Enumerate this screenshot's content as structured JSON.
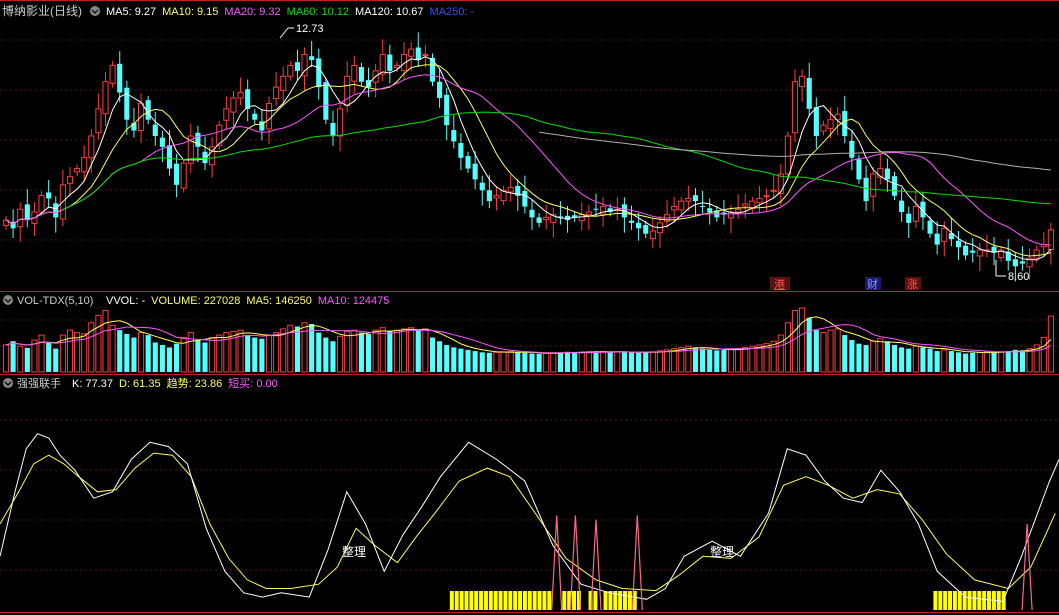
{
  "colors": {
    "bg": "#000000",
    "divider": "#c02020",
    "grid": "#551818",
    "up": "#ff3c3c",
    "down": "#54ffff",
    "ma5": "#ffffff",
    "ma10": "#ffff55",
    "ma20": "#ff55ff",
    "ma60": "#00e000",
    "ma120": "#b0b0b0",
    "ma250": "#3050ff",
    "k_line": "#ffffff",
    "d_line": "#ffff55",
    "trend_line": "#ffffff",
    "short_buy": "#ff6688",
    "yellow_bar": "#ffff00",
    "label_text": "#cccccc",
    "tag_bg": "#5a1010",
    "tag_bg_blue": "#1a1a6a"
  },
  "main_panel": {
    "title": "博纳影业(日线)",
    "indicators": [
      {
        "label": "MA5: 9.27",
        "color": "#ffffff"
      },
      {
        "label": "MA10: 9.15",
        "color": "#ffff55"
      },
      {
        "label": "MA20: 9.32",
        "color": "#ff55ff"
      },
      {
        "label": "MA60: 10.12",
        "color": "#00e000"
      },
      {
        "label": "MA120: 10.67",
        "color": "#ffffff"
      },
      {
        "label": "MA250: -",
        "color": "#3050ff"
      }
    ],
    "high_label": "12.73",
    "low_label": "8.60",
    "event_tags": [
      {
        "text": "港",
        "kind": "red"
      },
      {
        "text": "财",
        "kind": "blue"
      },
      {
        "text": "涨",
        "kind": "red"
      }
    ]
  },
  "volume_panel": {
    "title": "VOL-TDX(5,10)",
    "indicators": [
      {
        "label": "VVOL: -",
        "color": "#ffffff"
      },
      {
        "label": "VOLUME: 227028",
        "color": "#ffff55"
      },
      {
        "label": "MA5: 146250",
        "color": "#ffff55"
      },
      {
        "label": "MA10: 124475",
        "color": "#ff55ff"
      }
    ]
  },
  "oscillator_panel": {
    "title": "强强联手",
    "indicators": [
      {
        "label": "K: 77.37",
        "color": "#ffffff"
      },
      {
        "label": "D: 61.35",
        "color": "#ffff55"
      },
      {
        "label": "趋势: 23.86",
        "color": "#ffff55"
      },
      {
        "label": "短买: 0.00",
        "color": "#ff55ff"
      }
    ],
    "annotations": [
      "整理",
      "整理"
    ]
  },
  "chart_data": [
    {
      "type": "candlestick",
      "title": "博纳影业(日线)",
      "ylim": [
        8.2,
        13.1
      ],
      "closes": [
        9.45,
        9.3,
        9.65,
        9.45,
        9.6,
        9.9,
        9.85,
        9.5,
        10.1,
        10.25,
        10.4,
        10.6,
        11.0,
        11.5,
        12.0,
        12.3,
        11.8,
        11.3,
        11.1,
        11.6,
        11.3,
        11.0,
        10.8,
        10.4,
        10.1,
        10.5,
        11.0,
        10.8,
        10.5,
        10.8,
        11.2,
        11.5,
        11.7,
        11.8,
        11.5,
        11.3,
        11.1,
        11.6,
        11.9,
        12.1,
        12.3,
        12.2,
        12.5,
        12.4,
        11.9,
        11.3,
        11.0,
        11.5,
        12.1,
        12.3,
        12.0,
        11.9,
        12.2,
        12.5,
        12.2,
        12.3,
        12.5,
        12.6,
        12.4,
        12.5,
        12.0,
        11.7,
        11.2,
        10.9,
        10.6,
        10.4,
        10.2,
        10.0,
        9.8,
        9.9,
        10.0,
        10.05,
        9.9,
        9.7,
        9.5,
        9.4,
        9.5,
        9.55,
        9.5,
        9.45,
        9.5,
        9.55,
        9.6,
        9.65,
        9.7,
        9.6,
        9.65,
        9.5,
        9.4,
        9.3,
        9.2,
        9.25,
        9.4,
        9.55,
        9.7,
        9.8,
        9.85,
        9.8,
        9.7,
        9.6,
        9.5,
        9.55,
        9.6,
        9.65,
        9.75,
        9.8,
        9.85,
        9.9,
        10.0,
        10.3,
        11.0,
        12.0,
        12.1,
        11.5,
        11.0,
        11.2,
        11.3,
        11.4,
        11.0,
        10.6,
        10.2,
        9.8,
        10.3,
        10.4,
        10.2,
        9.9,
        9.6,
        9.4,
        9.7,
        9.5,
        9.2,
        9.0,
        9.3,
        9.1,
        8.95,
        8.8,
        8.85,
        8.9,
        8.9,
        8.85,
        8.9,
        8.7,
        8.6,
        8.65,
        8.75,
        8.9,
        9.0,
        9.27
      ],
      "volumes": [
        110000,
        125000,
        105000,
        98000,
        130000,
        150000,
        120000,
        95000,
        150000,
        170000,
        160000,
        155000,
        200000,
        230000,
        250000,
        190000,
        170000,
        155000,
        140000,
        160000,
        150000,
        120000,
        110000,
        100000,
        115000,
        140000,
        160000,
        130000,
        120000,
        140000,
        150000,
        160000,
        165000,
        170000,
        150000,
        140000,
        135000,
        150000,
        160000,
        175000,
        190000,
        185000,
        200000,
        195000,
        160000,
        140000,
        125000,
        145000,
        165000,
        170000,
        160000,
        155000,
        170000,
        180000,
        165000,
        170000,
        175000,
        180000,
        170000,
        175000,
        140000,
        125000,
        110000,
        100000,
        95000,
        90000,
        85000,
        80000,
        78000,
        80000,
        82000,
        83000,
        80000,
        78000,
        75000,
        74000,
        76000,
        78000,
        80000,
        82000,
        81000,
        80000,
        82000,
        84000,
        83000,
        80000,
        82000,
        81000,
        79000,
        78000,
        80000,
        82000,
        86000,
        90000,
        95000,
        100000,
        105000,
        100000,
        95000,
        90000,
        88000,
        90000,
        92000,
        95000,
        100000,
        105000,
        110000,
        115000,
        125000,
        150000,
        200000,
        250000,
        280000,
        220000,
        170000,
        160000,
        170000,
        175000,
        150000,
        130000,
        115000,
        110000,
        125000,
        135000,
        125000,
        110000,
        100000,
        95000,
        105000,
        100000,
        95000,
        85000,
        90000,
        85000,
        80000,
        75000,
        78000,
        80000,
        82000,
        80000,
        82000,
        85000,
        90000,
        88000,
        95000,
        110000,
        140000,
        227028
      ],
      "series": [
        {
          "name": "MA5"
        },
        {
          "name": "MA10"
        },
        {
          "name": "MA20"
        },
        {
          "name": "MA60"
        },
        {
          "name": "MA120"
        }
      ]
    },
    {
      "type": "bar",
      "title": "VOL-TDX(5,10)",
      "series": [
        {
          "name": "MA5"
        },
        {
          "name": "MA10"
        }
      ]
    },
    {
      "type": "line",
      "title": "强强联手",
      "ylim": [
        0,
        100
      ],
      "k_anchors": [
        [
          0,
          25
        ],
        [
          8,
          55
        ],
        [
          14,
          75
        ],
        [
          20,
          82
        ],
        [
          26,
          80
        ],
        [
          32,
          72
        ],
        [
          40,
          65
        ],
        [
          50,
          52
        ],
        [
          60,
          55
        ],
        [
          70,
          70
        ],
        [
          80,
          78
        ],
        [
          90,
          76
        ],
        [
          100,
          68
        ],
        [
          110,
          38
        ],
        [
          120,
          18
        ],
        [
          130,
          8
        ],
        [
          140,
          6
        ],
        [
          150,
          8
        ],
        [
          165,
          6
        ],
        [
          175,
          28
        ],
        [
          185,
          55
        ],
        [
          195,
          40
        ],
        [
          205,
          18
        ],
        [
          215,
          35
        ],
        [
          225,
          48
        ],
        [
          235,
          62
        ],
        [
          250,
          78
        ],
        [
          265,
          70
        ],
        [
          280,
          60
        ],
        [
          295,
          30
        ],
        [
          310,
          12
        ],
        [
          325,
          8
        ],
        [
          345,
          5
        ],
        [
          355,
          10
        ],
        [
          365,
          25
        ],
        [
          380,
          32
        ],
        [
          395,
          25
        ],
        [
          410,
          45
        ],
        [
          420,
          75
        ],
        [
          430,
          72
        ],
        [
          440,
          60
        ],
        [
          450,
          52
        ],
        [
          460,
          50
        ],
        [
          470,
          65
        ],
        [
          480,
          55
        ],
        [
          490,
          40
        ],
        [
          500,
          18
        ],
        [
          515,
          6
        ],
        [
          535,
          4
        ],
        [
          545,
          25
        ],
        [
          560,
          60
        ],
        [
          565,
          70
        ]
      ],
      "d_anchors": [
        [
          0,
          40
        ],
        [
          10,
          55
        ],
        [
          18,
          68
        ],
        [
          26,
          72
        ],
        [
          34,
          68
        ],
        [
          42,
          62
        ],
        [
          52,
          55
        ],
        [
          62,
          56
        ],
        [
          72,
          66
        ],
        [
          82,
          73
        ],
        [
          92,
          72
        ],
        [
          102,
          62
        ],
        [
          112,
          40
        ],
        [
          122,
          24
        ],
        [
          132,
          14
        ],
        [
          142,
          10
        ],
        [
          155,
          10
        ],
        [
          170,
          12
        ],
        [
          180,
          20
        ],
        [
          190,
          38
        ],
        [
          200,
          30
        ],
        [
          212,
          22
        ],
        [
          222,
          34
        ],
        [
          232,
          45
        ],
        [
          245,
          60
        ],
        [
          260,
          66
        ],
        [
          272,
          62
        ],
        [
          288,
          42
        ],
        [
          302,
          24
        ],
        [
          318,
          14
        ],
        [
          332,
          10
        ],
        [
          350,
          9
        ],
        [
          362,
          16
        ],
        [
          375,
          25
        ],
        [
          390,
          24
        ],
        [
          405,
          34
        ],
        [
          418,
          58
        ],
        [
          430,
          62
        ],
        [
          442,
          58
        ],
        [
          455,
          52
        ],
        [
          468,
          56
        ],
        [
          480,
          54
        ],
        [
          492,
          42
        ],
        [
          505,
          26
        ],
        [
          520,
          14
        ],
        [
          538,
          10
        ],
        [
          550,
          20
        ],
        [
          563,
          45
        ]
      ],
      "short_buy_spikes": [
        {
          "x": 297,
          "value": 44
        },
        {
          "x": 307,
          "value": 44
        },
        {
          "x": 318,
          "value": 42
        },
        {
          "x": 340,
          "value": 44
        },
        {
          "x": 548,
          "value": 40
        }
      ],
      "yellow_bar_ranges": [
        [
          240,
          294
        ],
        [
          300,
          308
        ],
        [
          314,
          318
        ],
        [
          322,
          338
        ],
        [
          498,
          537
        ]
      ]
    }
  ]
}
